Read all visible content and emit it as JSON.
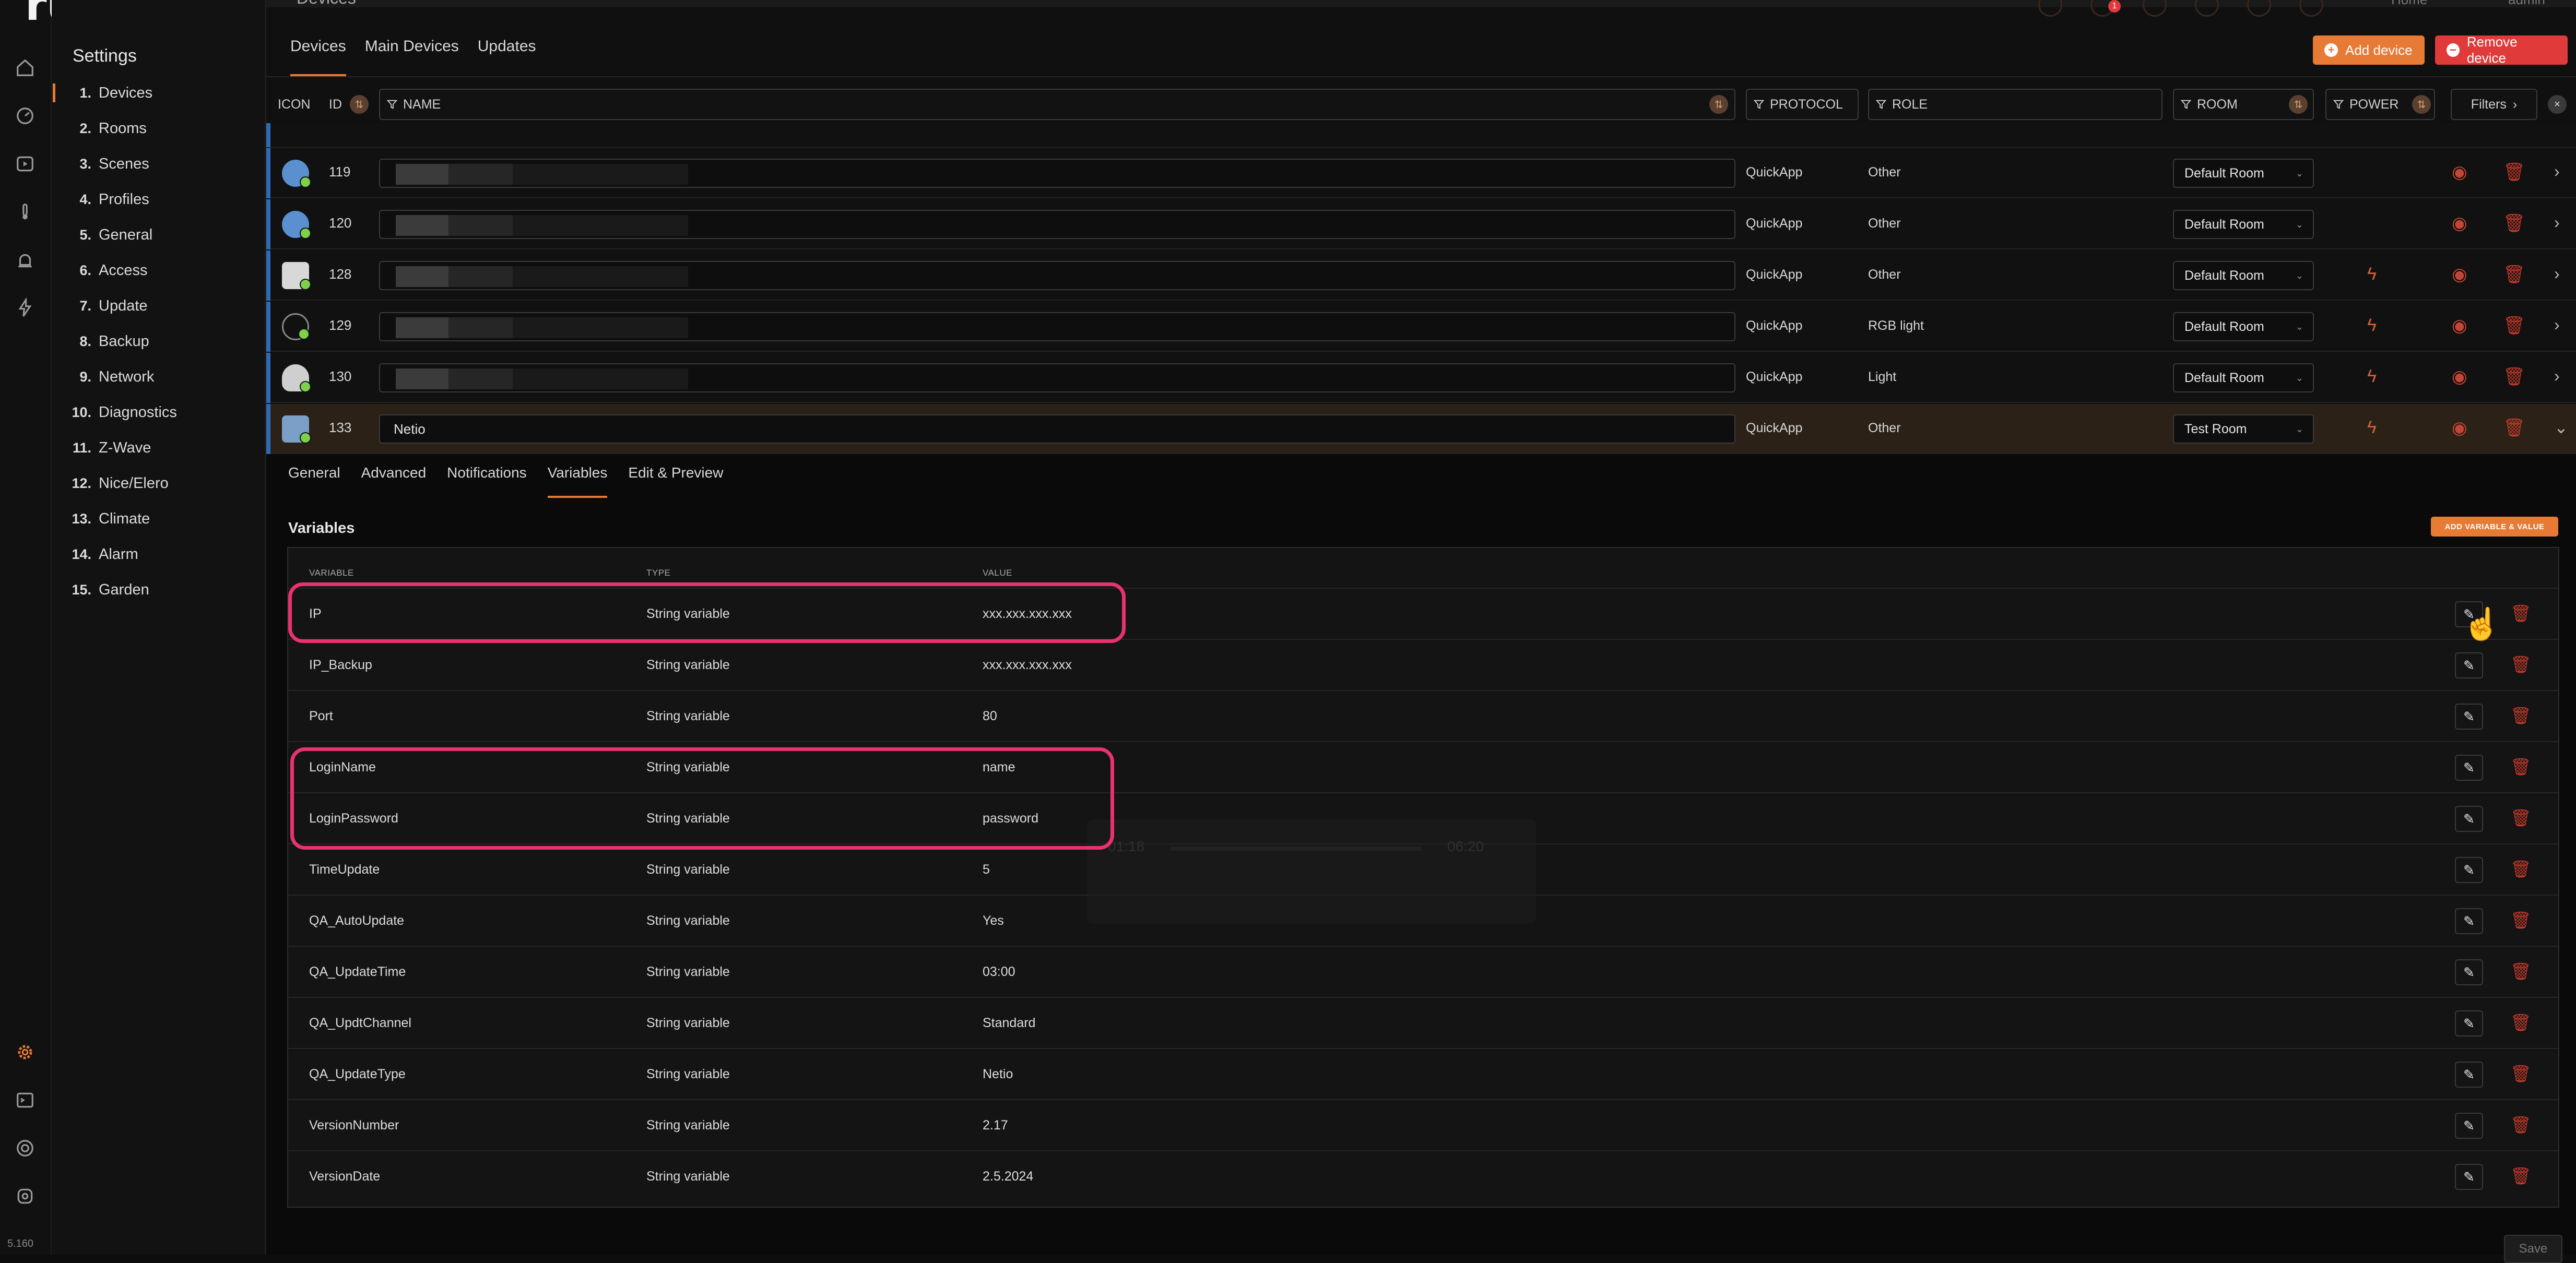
{
  "app": {
    "brand": "rubli",
    "version": "5.160"
  },
  "rail": {
    "icons": [
      "home-icon",
      "dashboard-icon",
      "scenes-icon",
      "climate-icon",
      "alarm-icon",
      "energy-icon"
    ],
    "bottom_icons": [
      "settings-icon",
      "terminal-icon",
      "support-icon",
      "help-icon"
    ]
  },
  "settings": {
    "title": "Settings",
    "items": [
      {
        "num": "1.",
        "label": "Devices",
        "active": true
      },
      {
        "num": "2.",
        "label": "Rooms"
      },
      {
        "num": "3.",
        "label": "Scenes"
      },
      {
        "num": "4.",
        "label": "Profiles"
      },
      {
        "num": "5.",
        "label": "General"
      },
      {
        "num": "6.",
        "label": "Access"
      },
      {
        "num": "7.",
        "label": "Update"
      },
      {
        "num": "8.",
        "label": "Backup"
      },
      {
        "num": "9.",
        "label": "Network"
      },
      {
        "num": "10.",
        "label": "Diagnostics"
      },
      {
        "num": "11.",
        "label": "Z-Wave"
      },
      {
        "num": "12.",
        "label": "Nice/Elero"
      },
      {
        "num": "13.",
        "label": "Climate"
      },
      {
        "num": "14.",
        "label": "Alarm"
      },
      {
        "num": "15.",
        "label": "Garden"
      }
    ]
  },
  "header": {
    "page_title": "Devices",
    "home_label": "Home",
    "user_label": "admin",
    "notif_count": "1"
  },
  "tabs": [
    "Devices",
    "Main Devices",
    "Updates"
  ],
  "toolbar": {
    "add_label": "Add device",
    "remove_label": "Remove device",
    "add_color": "#e77a35",
    "remove_color": "#e03a3a"
  },
  "columns": {
    "icon": "ICON",
    "id": "ID",
    "name": "NAME",
    "protocol": "PROTOCOL",
    "role": "ROLE",
    "room": "ROOM",
    "power": "POWER",
    "filters": "Filters"
  },
  "devices": [
    {
      "id": "119",
      "name": "",
      "protocol": "QuickApp",
      "role": "Other",
      "room": "Default Room",
      "power": false,
      "icon": "ie-icon"
    },
    {
      "id": "120",
      "name": "",
      "protocol": "QuickApp",
      "role": "Other",
      "room": "Default Room",
      "power": false,
      "icon": "ie-icon"
    },
    {
      "id": "128",
      "name": "",
      "protocol": "QuickApp",
      "role": "Other",
      "room": "Default Room",
      "power": true,
      "icon": "cube-icon"
    },
    {
      "id": "129",
      "name": "",
      "protocol": "QuickApp",
      "role": "RGB light",
      "room": "Default Room",
      "power": true,
      "icon": "ring-icon"
    },
    {
      "id": "130",
      "name": "",
      "protocol": "QuickApp",
      "role": "Light",
      "room": "Default Room",
      "power": true,
      "icon": "bulb-icon"
    },
    {
      "id": "133",
      "name": "Netio",
      "protocol": "QuickApp",
      "role": "Other",
      "room": "Test Room",
      "power": true,
      "icon": "unknown-device-icon",
      "selected": true
    }
  ],
  "subtabs": [
    "General",
    "Advanced",
    "Notifications",
    "Variables",
    "Edit & Preview"
  ],
  "variables_section": {
    "title": "Variables",
    "add_label": "ADD VARIABLE & VALUE",
    "headers": {
      "variable": "VARIABLE",
      "type": "TYPE",
      "value": "VALUE"
    },
    "rows": [
      {
        "name": "IP",
        "type": "String variable",
        "value": "xxx.xxx.xxx.xxx"
      },
      {
        "name": "IP_Backup",
        "type": "String variable",
        "value": "xxx.xxx.xxx.xxx"
      },
      {
        "name": "Port",
        "type": "String variable",
        "value": "80"
      },
      {
        "name": "LoginName",
        "type": "String variable",
        "value": "name"
      },
      {
        "name": "LoginPassword",
        "type": "String variable",
        "value": "password"
      },
      {
        "name": "TimeUpdate",
        "type": "String variable",
        "value": "5"
      },
      {
        "name": "QA_AutoUpdate",
        "type": "String variable",
        "value": "Yes"
      },
      {
        "name": "QA_UpdateTime",
        "type": "String variable",
        "value": "03:00"
      },
      {
        "name": "QA_UpdtChannel",
        "type": "String variable",
        "value": "Standard"
      },
      {
        "name": "QA_UpdateType",
        "type": "String variable",
        "value": "Netio"
      },
      {
        "name": "VersionNumber",
        "type": "String variable",
        "value": "2.17"
      },
      {
        "name": "VersionDate",
        "type": "String variable",
        "value": "2.5.2024"
      }
    ]
  },
  "overlay": {
    "time_start": "01:18",
    "time_end": "06:20"
  },
  "footer": {
    "save_label": "Save"
  },
  "colors": {
    "accent": "#e77a35",
    "highlight": "#e9326e",
    "danger": "#c0392b"
  }
}
